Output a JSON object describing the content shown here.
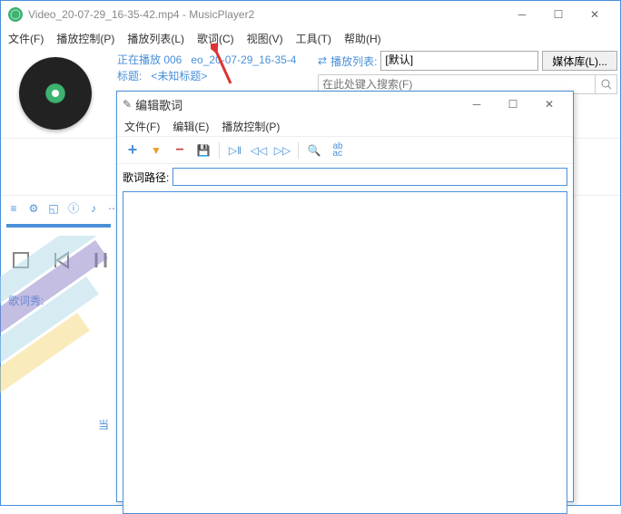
{
  "main": {
    "title": "Video_20-07-29_16-35-42.mp4 - MusicPlayer2",
    "menu": [
      "文件(F)",
      "播放控制(P)",
      "播放列表(L)",
      "歌词(C)",
      "视图(V)",
      "工具(T)",
      "帮助(H)"
    ],
    "now_playing": {
      "line1_prefix": "正在播放 006",
      "line1_file": "eo_20-07-29_16-35-4",
      "line2_label": "标题:",
      "line2_value": "<未知标题>"
    },
    "right": {
      "playlist_icon_label": "播放列表:",
      "playlist_selected": "[默认]",
      "library_button": "媒体库(L)...",
      "search_placeholder": "在此处键入搜索(F)"
    },
    "lyric_show": "歌词秀:",
    "dang": "当"
  },
  "sub": {
    "title": "编辑歌词",
    "menu": [
      "文件(F)",
      "编辑(E)",
      "播放控制(P)"
    ],
    "path_label": "歌词路径:"
  }
}
